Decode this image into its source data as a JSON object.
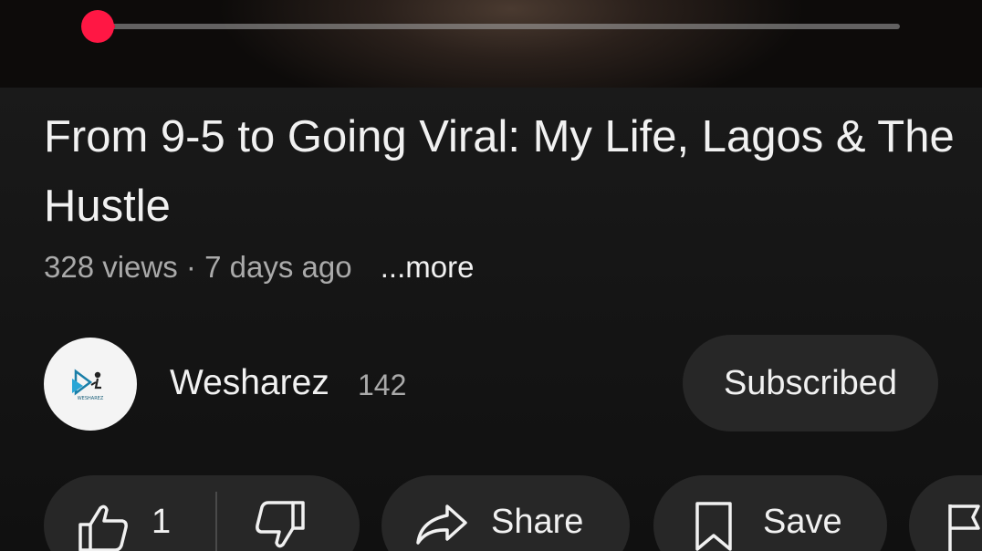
{
  "player": {
    "progress_fraction": 0.02,
    "accent_color": "#ff0033"
  },
  "video": {
    "title": "From 9-5 to Going Viral: My Life, Lagos & The Hustle",
    "views": "328 views",
    "separator": "·",
    "age": "7 days ago",
    "more_label": "...more"
  },
  "channel": {
    "name": "Wesharez",
    "subscriber_count": "142",
    "subscribe_label": "Subscribed",
    "avatar_logo_text": "WESHAREZ"
  },
  "actions": {
    "like_count": "1",
    "share_label": "Share",
    "save_label": "Save",
    "icons": [
      "thumbs-up-icon",
      "thumbs-down-icon",
      "share-arrow-icon",
      "bookmark-icon",
      "flag-icon"
    ]
  }
}
